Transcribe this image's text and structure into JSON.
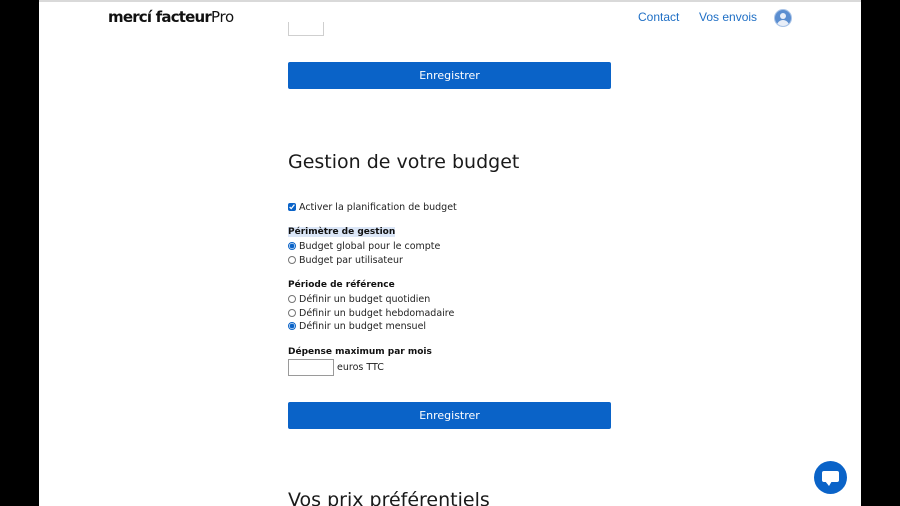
{
  "header": {
    "logo_main": "mercí facteur",
    "logo_suffix": "Pro",
    "nav": [
      {
        "label": "Contact"
      },
      {
        "label": "Vos envois"
      }
    ]
  },
  "save_label": "Enregistrer",
  "budget": {
    "title": "Gestion de votre budget",
    "enable_label": "Activer la planification de budget",
    "enable_checked": true,
    "scope": {
      "label": "Périmètre de gestion",
      "options": [
        {
          "label": "Budget global pour le compte",
          "checked": true
        },
        {
          "label": "Budget par utilisateur",
          "checked": false
        }
      ]
    },
    "period": {
      "label": "Période de référence",
      "options": [
        {
          "label": "Définir un budget quotidien",
          "checked": false
        },
        {
          "label": "Définir un budget hebdomadaire",
          "checked": false
        },
        {
          "label": "Définir un budget mensuel",
          "checked": true
        }
      ]
    },
    "max_spend": {
      "label": "Dépense maximum par mois",
      "value": "",
      "unit": "euros TTC"
    }
  },
  "next_section_title": "Vos prix préférentiels",
  "colors": {
    "primary": "#0a63c8",
    "link": "#1f6fc5"
  },
  "icons": {
    "avatar": "user-avatar-icon",
    "chat": "chat-bubble-icon"
  }
}
